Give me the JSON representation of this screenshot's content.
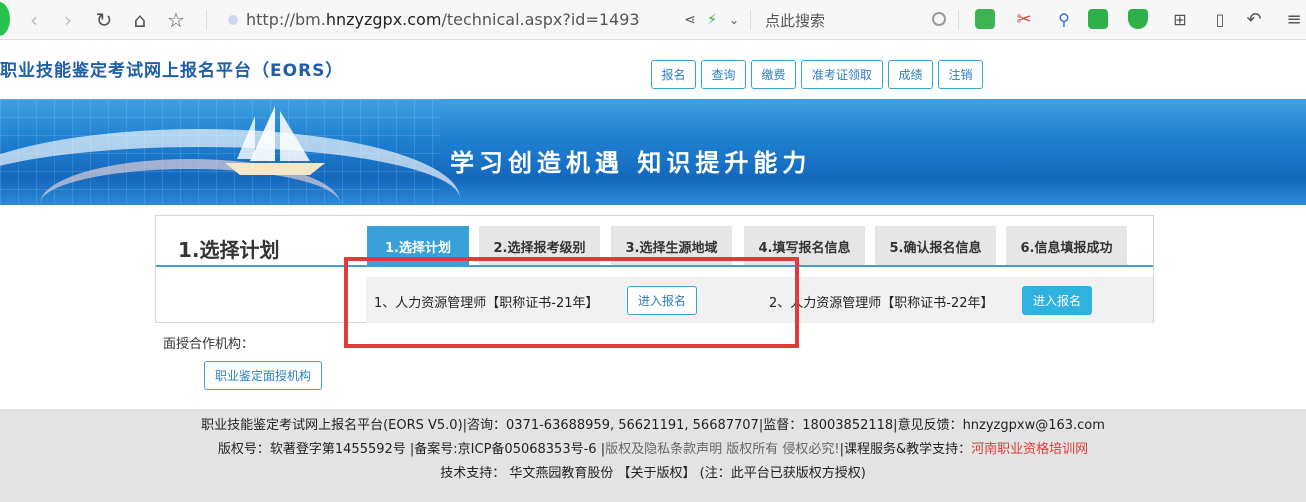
{
  "browser": {
    "url_prefix": "http://bm.",
    "url_domain": "hnzyzgpx.com",
    "url_suffix": "/technical.aspx?id=1493",
    "search_placeholder": "点此搜索",
    "icons": [
      "back-icon",
      "forward-icon",
      "refresh-icon",
      "home-icon",
      "star-icon",
      "share-icon",
      "lightning-icon",
      "chevron-down-icon",
      "search-icon",
      "translate-icon",
      "scissors-icon",
      "magnifier-icon",
      "gamepad-icon",
      "shield-icon",
      "apps-icon",
      "tablet-icon",
      "undo-icon",
      "menu-icon"
    ]
  },
  "site": {
    "title": "职业技能鉴定考试网上报名平台（EORS）",
    "nav": [
      "报名",
      "查询",
      "缴费",
      "准考证领取",
      "成绩",
      "注销"
    ]
  },
  "banner": {
    "slogan": "学习创造机遇  知识提升能力"
  },
  "panel": {
    "title": "1.选择计划",
    "tabs": [
      "1.选择计划",
      "2.选择报考级别",
      "3.选择生源地域",
      "4.填写报名信息",
      "5.确认报名信息",
      "6.信息填报成功"
    ],
    "plans": [
      {
        "label": "1、人力资源管理师【职称证书-21年】",
        "button": "进入报名"
      },
      {
        "label": "2、人力资源管理师【职称证书-22年】",
        "button": "进入报名"
      }
    ]
  },
  "coop": {
    "label": "面授合作机构：",
    "button": "职业鉴定面授机构"
  },
  "footer": {
    "line1": "职业技能鉴定考试网上报名平台(EORS V5.0)|咨询：0371-63688959, 56621191, 56687707|监督：18003852118|意见反馈：hnzyzgpxw@163.com",
    "line2_a": "版权号：软著登字第1455592号 |备案号:京ICP备05068353号-6 |",
    "line2_b": "版权及隐私条款声明 版权所有 侵权必究!",
    "line2_c": "|课程服务&教学支持：",
    "line2_d": "河南职业资格培训网",
    "line3": "技术支持： 华文燕园教育股份 【关于版权】 (注：此平台已获版权方授权)"
  },
  "colors": {
    "accent": "#3aa0d8",
    "highlight": "#e03a3a",
    "title_blue": "#1e5fa8"
  }
}
